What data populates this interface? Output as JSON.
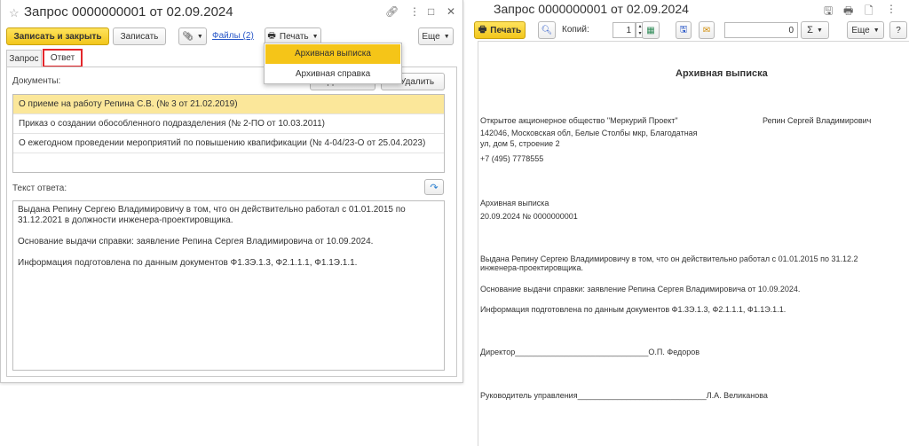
{
  "left": {
    "title": "Запрос 0000000001 от 02.09.2024",
    "toolbar": {
      "save_close": "Записать и закрыть",
      "save": "Записать",
      "files": "Файлы (2)",
      "print": "Печать",
      "more": "Еще"
    },
    "tabs": [
      "Запрос",
      "Ответ"
    ],
    "documents_label": "Документы:",
    "add_button": "Добавить",
    "delete_button": "Удалить",
    "documents": [
      "О приеме на работу Репина С.В. (№ 3 от 21.02.2019)",
      "Приказ о создании обособленного подразделения (№ 2-ПО от 10.03.2011)",
      "О ежегодном проведении мероприятий по повышению квапификации (№ 4-04/23-О от 25.04.2023)"
    ],
    "answer_label": "Текст ответа:",
    "answer_text": [
      "Выдана Репину Сергею Владимировичу в том, что он действительно работал с 01.01.2015 по 31.12.2021 в должности инженера-проектировщика.",
      "Основание выдачи справки: заявление Репина Сергея Владимировича от 10.09.2024.",
      "Информация подготовлена по данным документов Ф1.3Э.1.3, Ф2.1.1.1, Ф1.1Э.1.1."
    ],
    "print_menu": [
      "Архивная выписка",
      "Архивная справка"
    ]
  },
  "right": {
    "title": "Запрос 0000000001 от 02.09.2024",
    "toolbar": {
      "print": "Печать",
      "copies_label": "Копий:",
      "copies_value": "1",
      "sum_value": "0",
      "sigma": "Σ",
      "more": "Еще",
      "help": "?"
    },
    "doc": {
      "heading": "Архивная выписка",
      "org_line1": "Открытое акционерное общество \"Меркурий Проект\"",
      "org_line2": "142046, Московская обл, Белые Столбы мкр, Благодатная",
      "org_line3": "ул, дом 5, строение 2",
      "phone": "+7 (495) 7778555",
      "recipient": "Репин Сергей Владимирович",
      "doc_type": "Архивная выписка",
      "doc_date_no": "20.09.2024 № 0000000001",
      "body1": "Выдана Репину Сергею Владимировичу в том, что он действительно работал с 01.01.2015 по 31.12.2",
      "body1b": "инженера-проектировщика.",
      "body2": "Основание выдачи справки: заявление Репина Сергея Владимировича от 10.09.2024.",
      "body3": "Информация подготовлена по данным документов Ф1.3Э.1.3, Ф2.1.1.1, Ф1.1Э.1.1.",
      "director_label": "Директор",
      "director_line": "______________________________",
      "director_name": "О.П. Федоров",
      "head_label": "Руководитель управления",
      "head_line": "_____________________________",
      "head_name": "Л.А. Великанова"
    }
  }
}
